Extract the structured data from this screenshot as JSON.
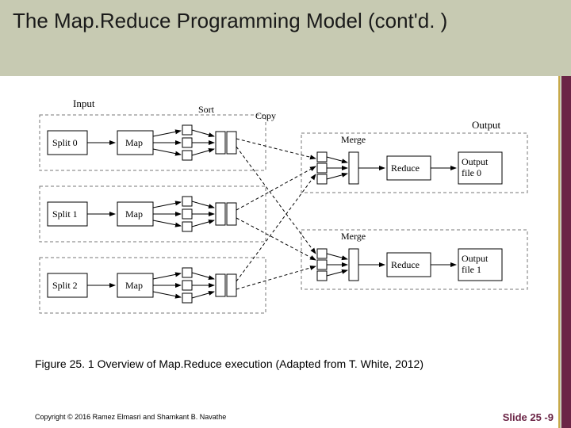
{
  "header": {
    "title": "The Map.Reduce Programming Model (cont'd. )"
  },
  "diagram": {
    "labels": {
      "input": "Input",
      "sort": "Sort",
      "copy": "Copy",
      "merge1": "Merge",
      "merge2": "Merge",
      "output": "Output"
    },
    "splits": [
      "Split 0",
      "Split 1",
      "Split 2"
    ],
    "map": "Map",
    "reduce": "Reduce",
    "outputs": [
      "Output file 0",
      "Output file 1"
    ]
  },
  "caption": "Figure 25. 1 Overview of Map.Reduce execution (Adapted from T. White, 2012)",
  "footer": {
    "copyright": "Copyright © 2016 Ramez Elmasri and Shamkant B. Navathe",
    "slide": "Slide 25 -9"
  }
}
